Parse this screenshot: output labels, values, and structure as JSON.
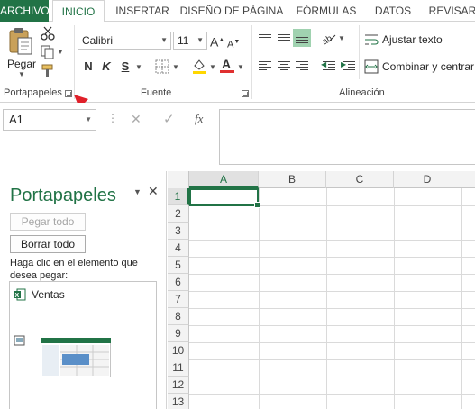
{
  "ribbon_tabs": [
    "ARCHIVO",
    "INICIO",
    "INSERTAR",
    "DISEÑO DE PÁGINA",
    "FÓRMULAS",
    "DATOS",
    "REVISAR"
  ],
  "active_tab": "INICIO",
  "clipboard_group": {
    "label": "Portapapeles",
    "paste_label": "Pegar"
  },
  "font_group": {
    "label": "Fuente",
    "font_name": "Calibri",
    "font_size": "11",
    "bold": "N",
    "italic": "K",
    "underline": "S"
  },
  "alignment_group": {
    "label": "Alineación",
    "wrap_text": "Ajustar texto",
    "merge_center": "Combinar y centrar"
  },
  "formula_bar": {
    "name_box": "A1",
    "fx": "fx",
    "value": ""
  },
  "clipboard_pane": {
    "title": "Portapapeles",
    "paste_all": "Pegar todo",
    "clear_all": "Borrar todo",
    "hint": "Haga clic en el elemento que desea pegar:",
    "items": [
      {
        "type": "excel",
        "text": "Ventas"
      },
      {
        "type": "image",
        "text": ""
      }
    ]
  },
  "sheet": {
    "columns": [
      "A",
      "B",
      "C",
      "D"
    ],
    "rows": [
      "1",
      "2",
      "3",
      "4",
      "5",
      "6",
      "7",
      "8",
      "9",
      "10",
      "11",
      "12",
      "13"
    ],
    "active_cell": "A1"
  },
  "colors": {
    "accent": "#217346",
    "arrow": "#e0202a",
    "fill_color": "#ffd700",
    "font_color": "#e03030"
  }
}
